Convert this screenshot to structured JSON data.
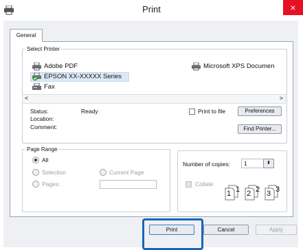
{
  "window": {
    "title": "Print",
    "close_glyph": "×"
  },
  "tabs": [
    {
      "label": "General"
    }
  ],
  "select_printer": {
    "legend": "Select Printer",
    "printers": [
      {
        "name": "Adobe PDF",
        "icon": "printer-icon"
      },
      {
        "name": "EPSON XX-XXXXX Series",
        "icon": "printer-default-icon",
        "selected": true
      },
      {
        "name": "Fax",
        "icon": "fax-icon"
      },
      {
        "name": "Microsoft XPS Documen",
        "icon": "printer-icon"
      }
    ],
    "scroll_left": "<",
    "scroll_right": ">",
    "status_label": "Status:",
    "status_value": "Ready",
    "location_label": "Location:",
    "comment_label": "Comment:",
    "print_to_file_label": "Print to file",
    "preferences_label": "Preferences",
    "find_printer_label": "Find Printer..."
  },
  "page_range": {
    "legend": "Page Range",
    "all_label": "All",
    "selection_label": "Selection",
    "current_page_label": "Current Page",
    "pages_label": "Pages:",
    "selected": "All"
  },
  "copies": {
    "number_label": "Number of copies:",
    "value": "1",
    "collate_label": "Collate",
    "collate_pages": [
      "1",
      "1",
      "2",
      "2",
      "3",
      "3"
    ]
  },
  "buttons": {
    "print": "Print",
    "cancel": "Cancel",
    "apply": "Apply"
  },
  "colors": {
    "accent_highlight": "#1766b5",
    "close_red": "#e81123",
    "selected_row": "#dde8f6"
  }
}
